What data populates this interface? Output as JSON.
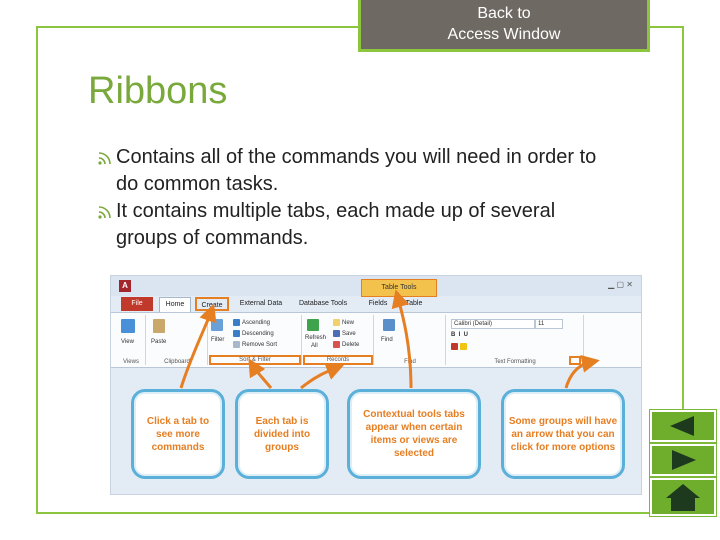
{
  "back_button": {
    "line1": "Back to",
    "line2": "Access Window"
  },
  "slide": {
    "title": "Ribbons",
    "bullets": [
      "Contains all of the commands you will need in order to do common tasks.",
      "It contains multiple tabs, each made up of several groups of commands."
    ]
  },
  "screenshot": {
    "tab_context_title": "Table Tools",
    "tabs": [
      "File",
      "Home",
      "Create",
      "External Data",
      "Database Tools",
      "Fields",
      "Table"
    ],
    "groups": [
      "Views",
      "Clipboard",
      "Sort & Filter",
      "Records",
      "Find",
      "Text Formatting"
    ],
    "items": {
      "view": "View",
      "paste": "Paste",
      "filter": "Filter",
      "ascending": "Ascending",
      "descending": "Descending",
      "remove_sort": "Remove Sort",
      "refresh": "Refresh",
      "refresh_sub": "All",
      "new": "New",
      "save": "Save",
      "delete": "Delete",
      "find": "Find",
      "font": "Calibri (Detail)",
      "font_size": "11"
    },
    "callouts": [
      "Click a tab to see more commands",
      "Each tab is divided into groups",
      "Contextual tools tabs appear when certain items or views are selected",
      "Some groups will have an arrow that you can click for more options"
    ]
  },
  "nav_icons": [
    "previous-slide-icon",
    "next-slide-icon",
    "home-icon"
  ],
  "colors": {
    "accent": "#8cc63f",
    "title": "#79a93b",
    "callout_text": "#e67e22",
    "callout_border": "#5ab0d8",
    "button_bg": "#6e6a63"
  }
}
